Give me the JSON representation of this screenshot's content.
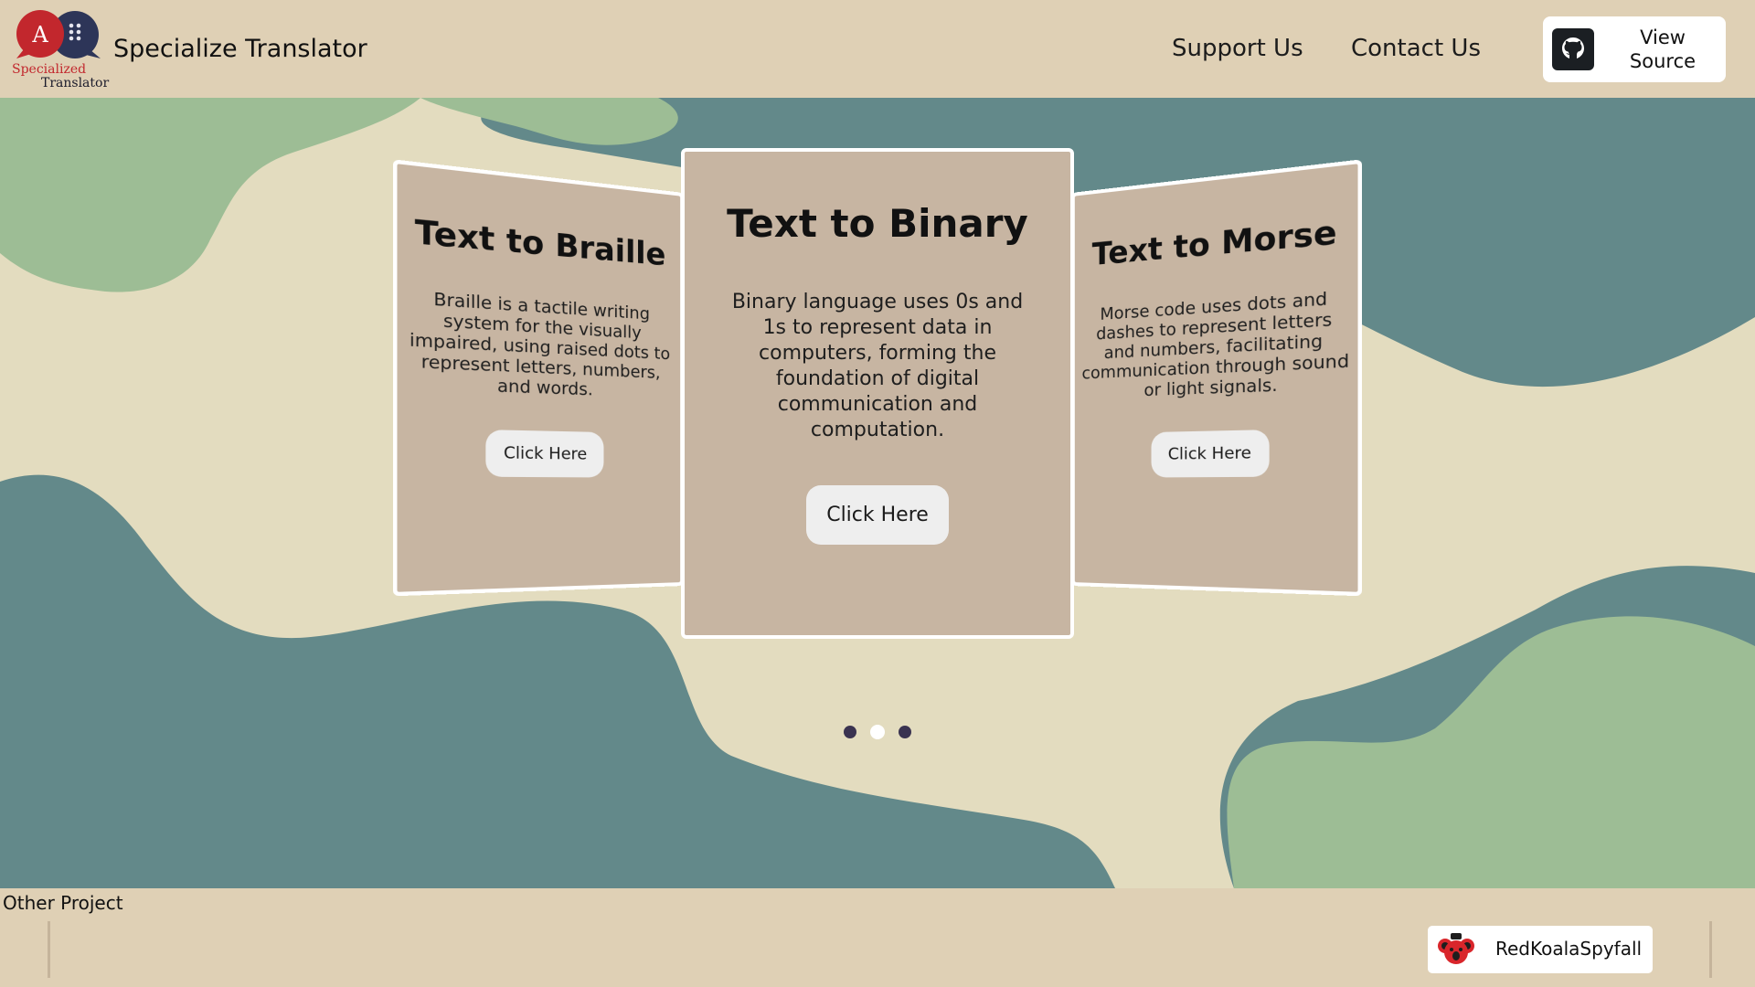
{
  "header": {
    "logo_text_top": "Specialized",
    "logo_text_bottom": "Translator",
    "logo_letter": "A",
    "brand": "Specialize Translator",
    "nav": [
      "Support Us",
      "Contact Us"
    ],
    "view_source": "View Source",
    "icons": {
      "logo": "translator-logo",
      "github": "github-icon"
    }
  },
  "carousel": {
    "cards": [
      {
        "title": "Text to Braille",
        "description": "Braille is a tactile writing system for the visually impaired, using raised dots to represent letters, numbers, and words.",
        "button": "Click Here"
      },
      {
        "title": "Text to Binary",
        "description": "Binary language uses 0s and 1s to represent data in computers, forming the foundation of digital communication and computation.",
        "button": "Click Here"
      },
      {
        "title": "Text to Morse",
        "description": "Morse code uses dots and dashes to represent letters and numbers, facilitating communication through sound or light signals.",
        "button": "Click Here"
      }
    ],
    "active_index": 1,
    "dot_count": 3
  },
  "footer": {
    "title": "Other Project",
    "projects": [
      {
        "name": "RedKoalaSpyfall",
        "icon": "koala-icon"
      }
    ]
  },
  "colors": {
    "header_bg": "#dfd0b5",
    "card_bg": "#c7b5a2",
    "wave_teal": "#63898a",
    "wave_green": "#9dbd95",
    "wave_cream": "#e3dcbf",
    "logo_red": "#c2272d",
    "logo_navy": "#2d3558"
  }
}
